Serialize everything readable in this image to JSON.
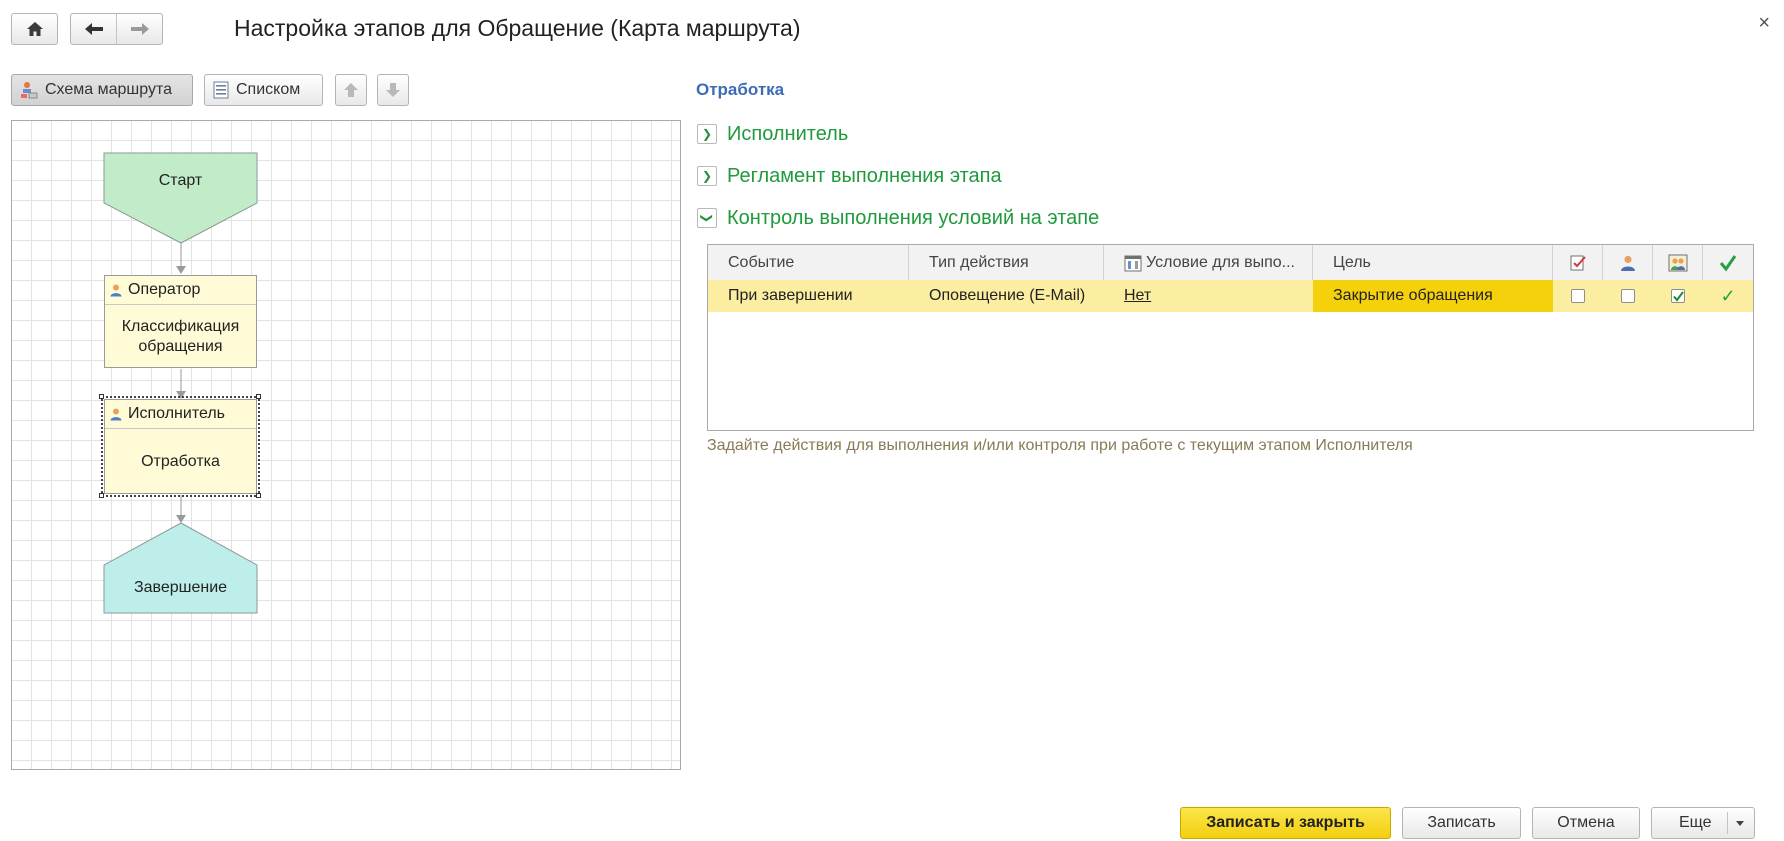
{
  "window": {
    "title": "Настройка этапов для Обращение (Карта маршрута)",
    "close_glyph": "×",
    "home_icon": "home-icon",
    "back_icon": "arrow-left-icon",
    "forward_icon": "arrow-right-icon"
  },
  "left_toolbar": {
    "scheme_label": "Схема маршрута",
    "list_label": "Списком"
  },
  "diagram": {
    "start_label": "Старт",
    "operator": {
      "role": "Оператор",
      "stage": "Классификация обращения"
    },
    "executor": {
      "role": "Исполнитель",
      "stage": "Отработка"
    },
    "finish_label": "Завершение",
    "colors": {
      "start": "#c2ecc9",
      "stage": "#fffbd6",
      "finish": "#bdeeea"
    }
  },
  "panel": {
    "section_title": "Отработка",
    "groups": [
      {
        "label": "Исполнитель",
        "state": "collapsed"
      },
      {
        "label": "Регламент выполнения этапа",
        "state": "collapsed"
      },
      {
        "label": "Контроль выполнения условий на этапе",
        "state": "expanded"
      }
    ],
    "table": {
      "columns": [
        "Событие",
        "Тип действия",
        "Условие для выпо...",
        "Цель"
      ],
      "icon_columns": [
        "task-icon",
        "user-icon",
        "users-icon",
        "checkmark-icon"
      ],
      "rows": [
        {
          "event": "При завершении",
          "action": "Оповещение (E-Mail)",
          "condition": "Нет",
          "target": "Закрытие обращения",
          "flag1": false,
          "flag2": false,
          "flag3": true,
          "done_glyph": "✓"
        }
      ]
    },
    "hint": "Задайте действия для выполнения и/или контроля при работе с текущим этапом Исполнителя"
  },
  "footer": {
    "save_close": "Записать и закрыть",
    "save": "Записать",
    "cancel": "Отмена",
    "more": "Еще"
  },
  "colors": {
    "group_green": "#1f9a3c",
    "section_blue": "#3d6bb5",
    "row_highlight": "#fbeea0",
    "target_cell": "#f5d10b",
    "primary_button": "#f5d516"
  }
}
